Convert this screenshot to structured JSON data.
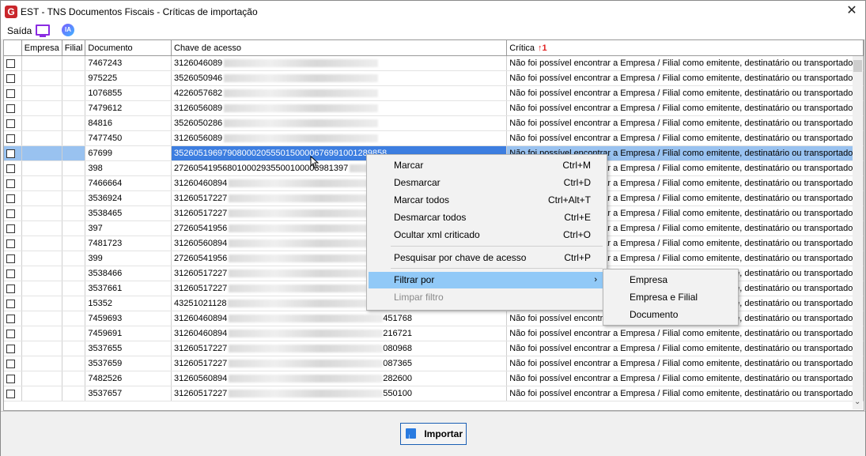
{
  "window": {
    "title": "EST - TNS Documentos Fiscais - Críticas de importação",
    "logo": "G",
    "close": "✕"
  },
  "menu": {
    "saida": "Saída",
    "ia": "IA"
  },
  "grid": {
    "headers": [
      "",
      "Empresa",
      "Filial",
      "Documento",
      "Chave de acesso",
      "Crítica"
    ],
    "sort_indicator": "1",
    "rows": [
      {
        "doc": "7467243",
        "key_prefix": "3126046089",
        "key_suffix": "",
        "msg": "Não foi possível encontrar a Empresa / Filial como emitente, destinatário ou transportador."
      },
      {
        "doc": "975225",
        "key_prefix": "3526050946",
        "key_suffix": "",
        "msg": "Não foi possível encontrar a Empresa / Filial como emitente, destinatário ou transportador."
      },
      {
        "doc": "1076855",
        "key_prefix": "4226057682",
        "key_suffix": "",
        "msg": "Não foi possível encontrar a Empresa / Filial como emitente, destinatário ou transportador."
      },
      {
        "doc": "7479612",
        "key_prefix": "3126056089",
        "key_suffix": "",
        "msg": "Não foi possível encontrar a Empresa / Filial como emitente, destinatário ou transportador."
      },
      {
        "doc": "84816",
        "key_prefix": "3526050286",
        "key_suffix": "",
        "msg": "Não foi possível encontrar a Empresa / Filial como emitente, destinatário ou transportador."
      },
      {
        "doc": "7477450",
        "key_prefix": "3126056089",
        "key_suffix": "",
        "msg": "Não foi possível encontrar a Empresa / Filial como emitente, destinatário ou transportador."
      },
      {
        "doc": "67699",
        "key_prefix": "35260519697908000205550150000676991001289858",
        "key_suffix": "",
        "msg": "Não foi possível encontrar a Empresa / Filial como emitente, destinatário ou transportador.",
        "selected": true
      },
      {
        "doc": "398",
        "key_prefix": "272605419568010002935500100003981397",
        "key_suffix": "",
        "msg": "Não foi possível encontrar a Empresa / Filial como emitente, destinatário ou transportador."
      },
      {
        "doc": "7466664",
        "key_prefix": "31260460894",
        "key_suffix": "",
        "msg": "Não foi possível encontrar a Empresa / Filial como emitente, destinatário ou transportador."
      },
      {
        "doc": "3536924",
        "key_prefix": "31260517227",
        "key_suffix": "",
        "msg": "Não foi possível encontrar a Empresa / Filial como emitente, destinatário ou transportador."
      },
      {
        "doc": "3538465",
        "key_prefix": "31260517227",
        "key_suffix": "",
        "msg": "Não foi possível encontrar a Empresa / Filial como emitente, destinatário ou transportador."
      },
      {
        "doc": "397",
        "key_prefix": "27260541956",
        "key_suffix": "",
        "msg": "Não foi possível encontrar a Empresa / Filial como emitente, destinatário ou transportador."
      },
      {
        "doc": "7481723",
        "key_prefix": "31260560894",
        "key_suffix": "",
        "msg": "Não foi possível encontrar a Empresa / Filial como emitente, destinatário ou transportador."
      },
      {
        "doc": "399",
        "key_prefix": "27260541956",
        "key_suffix": "",
        "msg": "Não foi possível encontrar a Empresa / Filial como emitente, destinatário ou transportador."
      },
      {
        "doc": "3538466",
        "key_prefix": "31260517227",
        "key_suffix": "",
        "msg": "Não foi possível encontrar a Empresa / Filial como emitente, destinatário ou transportador."
      },
      {
        "doc": "3537661",
        "key_prefix": "31260517227",
        "key_suffix": "",
        "msg": "Não foi possível encontrar a Empresa / Filial como emitente, destinatário ou transportador."
      },
      {
        "doc": "15352",
        "key_prefix": "43251021128",
        "key_suffix": "",
        "msg": "Não foi possível encontrar a Empresa / Filial como emitente, destinatário ou transportador."
      },
      {
        "doc": "7459693",
        "key_prefix": "31260460894",
        "key_suffix": "451768",
        "msg": "Não foi possível encontrar a Empresa / Filial como emitente, destinatário ou transportador."
      },
      {
        "doc": "7459691",
        "key_prefix": "31260460894",
        "key_suffix": "216721",
        "msg": "Não foi possível encontrar a Empresa / Filial como emitente, destinatário ou transportador."
      },
      {
        "doc": "3537655",
        "key_prefix": "31260517227",
        "key_suffix": "080968",
        "msg": "Não foi possível encontrar a Empresa / Filial como emitente, destinatário ou transportador."
      },
      {
        "doc": "3537659",
        "key_prefix": "31260517227",
        "key_suffix": "087365",
        "msg": "Não foi possível encontrar a Empresa / Filial como emitente, destinatário ou transportador."
      },
      {
        "doc": "7482526",
        "key_prefix": "31260560894",
        "key_suffix": "282600",
        "msg": "Não foi possível encontrar a Empresa / Filial como emitente, destinatário ou transportador."
      },
      {
        "doc": "3537657",
        "key_prefix": "31260517227",
        "key_suffix": "550100",
        "msg": "Não foi possível encontrar a Empresa / Filial como emitente, destinatário ou transportador."
      }
    ]
  },
  "context_menu": {
    "items": [
      {
        "label": "Marcar",
        "shortcut": "Ctrl+M"
      },
      {
        "label": "Desmarcar",
        "shortcut": "Ctrl+D"
      },
      {
        "label": "Marcar todos",
        "shortcut": "Ctrl+Alt+T"
      },
      {
        "label": "Desmarcar todos",
        "shortcut": "Ctrl+E"
      },
      {
        "label": "Ocultar xml criticado",
        "shortcut": "Ctrl+O"
      },
      {
        "label": "Pesquisar por chave de acesso",
        "shortcut": "Ctrl+P"
      },
      {
        "label": "Filtrar por",
        "shortcut": "›"
      },
      {
        "label": "Limpar filtro",
        "shortcut": ""
      }
    ]
  },
  "submenu": {
    "items": [
      "Empresa",
      "Empresa e Filial",
      "Documento"
    ]
  },
  "footer": {
    "import_label": "Importar"
  },
  "colors": {
    "selection": "#99c2f0",
    "key_highlight": "#3d7ee0",
    "menu_hover": "#91c9f7",
    "button_border": "#1a5fb4"
  }
}
